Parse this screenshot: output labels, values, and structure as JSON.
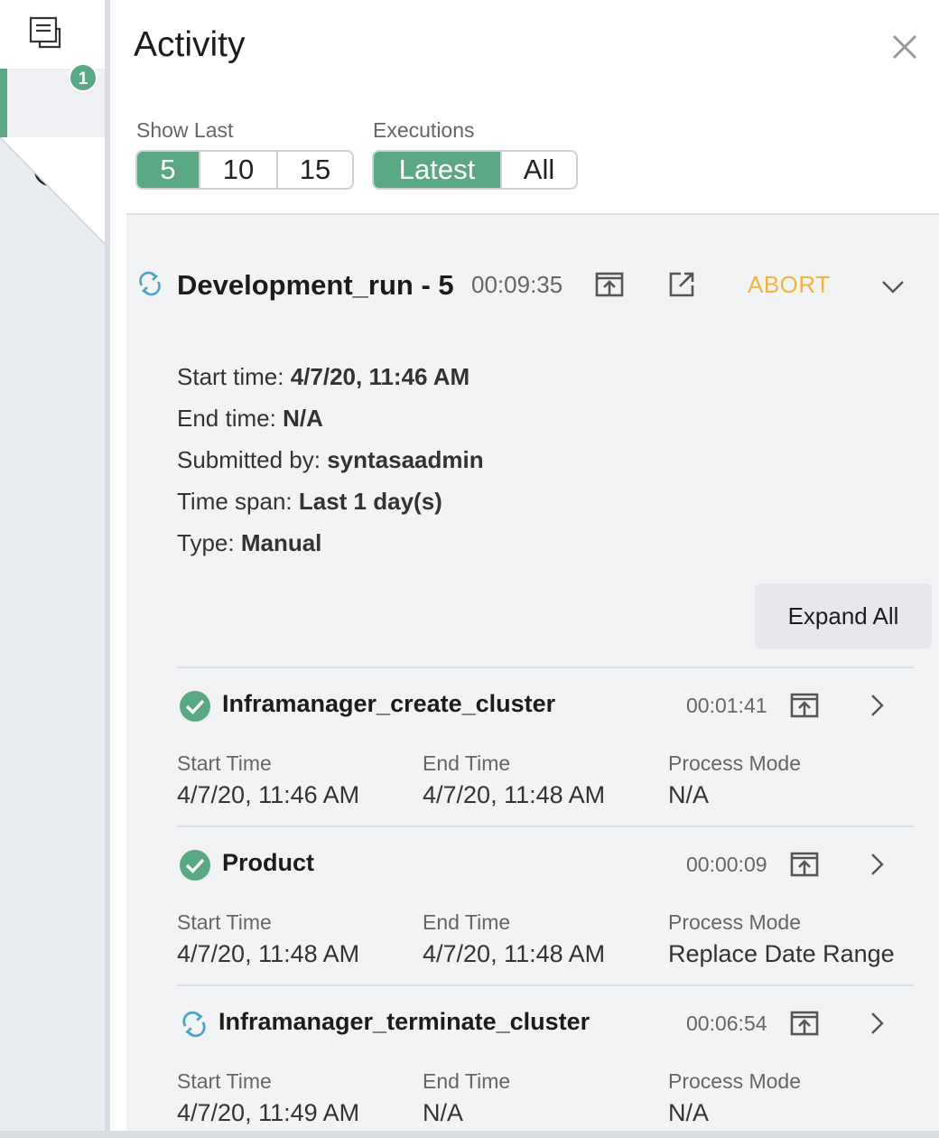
{
  "sidebar": {
    "badge_count": "1",
    "accent_color": "#5aa884"
  },
  "panel": {
    "title": "Activity",
    "show_last": {
      "label": "Show Last",
      "options": [
        "5",
        "10",
        "15"
      ],
      "selected": "5"
    },
    "executions": {
      "label": "Executions",
      "options": [
        "Latest",
        "All"
      ],
      "selected": "Latest"
    }
  },
  "run": {
    "name": "Development_run - 5",
    "duration": "00:09:35",
    "abort_label": "ABORT",
    "abort_color": "#f2b43c",
    "details": [
      {
        "label": "Start time: ",
        "value": "4/7/20, 11:46 AM"
      },
      {
        "label": "End time: ",
        "value": "N/A"
      },
      {
        "label": "Submitted by: ",
        "value": "syntasaadmin"
      },
      {
        "label": "Time span: ",
        "value": "Last 1 day(s)"
      },
      {
        "label": "Type: ",
        "value": "Manual"
      }
    ],
    "expand_all_label": "Expand All"
  },
  "tasks": [
    {
      "name": "Inframanager_create_cluster",
      "status": "completed",
      "duration": "00:01:41",
      "start_label": "Start Time",
      "start": "4/7/20, 11:46 AM",
      "end_label": "End Time",
      "end": "4/7/20, 11:48 AM",
      "mode_label": "Process Mode",
      "mode": "N/A"
    },
    {
      "name": "Product",
      "status": "completed",
      "duration": "00:00:09",
      "start_label": "Start Time",
      "start": "4/7/20, 11:48 AM",
      "end_label": "End Time",
      "end": "4/7/20, 11:48 AM",
      "mode_label": "Process Mode",
      "mode": "Replace Date Range"
    },
    {
      "name": "Inframanager_terminate_cluster",
      "status": "running",
      "duration": "00:06:54",
      "start_label": "Start Time",
      "start": "4/7/20, 11:49 AM",
      "end_label": "End Time",
      "end": "N/A",
      "mode_label": "Process Mode",
      "mode": "N/A"
    }
  ]
}
